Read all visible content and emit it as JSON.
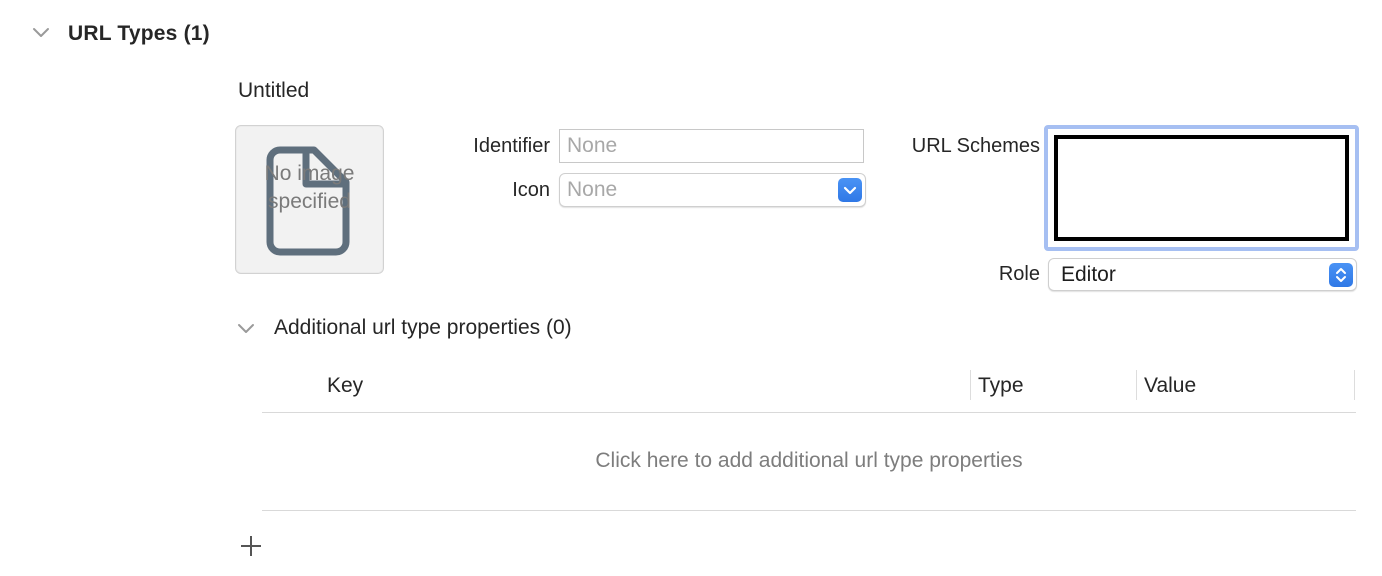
{
  "section": {
    "title": "URL Types (1)",
    "disclosure_icon": "chevron-down-icon"
  },
  "url_type": {
    "name": "Untitled",
    "image_well": {
      "icon": "document-icon",
      "placeholder": "No image specified"
    },
    "identifier": {
      "label": "Identifier",
      "placeholder": "None",
      "value": ""
    },
    "icon": {
      "label": "Icon",
      "value": "None",
      "chevron_icon": "up-down-chevron-icon"
    },
    "url_schemes": {
      "label": "URL Schemes",
      "value": ""
    },
    "role": {
      "label": "Role",
      "value": "Editor",
      "chevron_icon": "up-down-chevron-icon"
    }
  },
  "additional": {
    "title": "Additional url type properties (0)",
    "disclosure_icon": "chevron-down-icon",
    "columns": [
      "Key",
      "Type",
      "Value"
    ],
    "empty_hint": "Click here to add additional url type properties"
  },
  "add_button": {
    "icon": "plus-icon"
  },
  "colors": {
    "accent": "#2f78e6",
    "focus_ring": "#a6bff2",
    "placeholder_text": "#a8a8a8"
  }
}
